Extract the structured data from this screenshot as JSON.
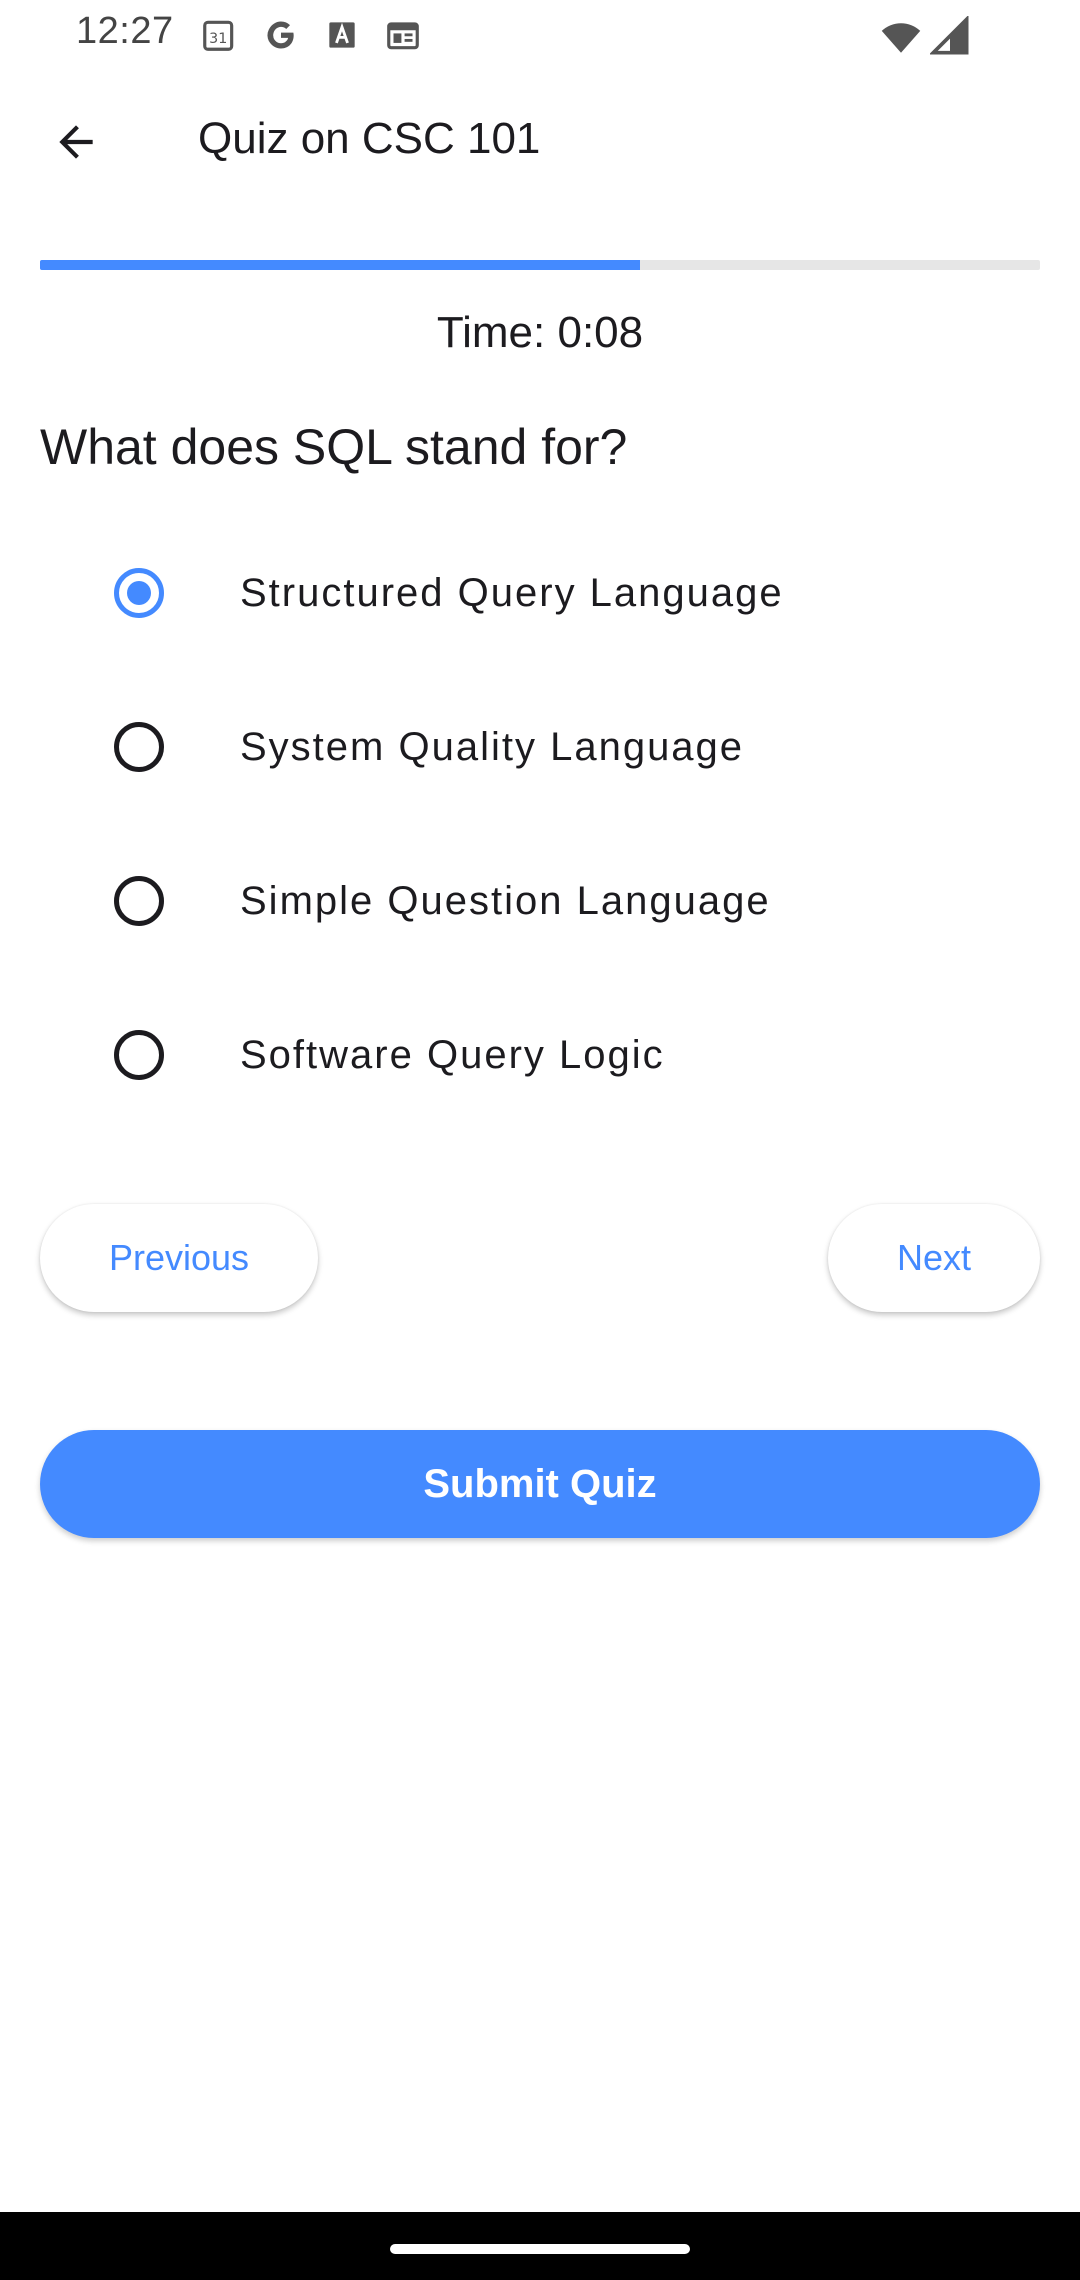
{
  "status_bar": {
    "time": "12:27",
    "calendar_icon_text": "31",
    "icons": [
      "calendar-icon",
      "google-icon",
      "font-icon",
      "news-icon",
      "wifi-icon",
      "signal-icon"
    ]
  },
  "app_bar": {
    "title": "Quiz on CSC 101",
    "back_icon": "arrow-back-icon"
  },
  "progress": {
    "fraction": 0.6
  },
  "timer": {
    "text": "Time: 0:08"
  },
  "question": {
    "text": "What does SQL stand for?",
    "options": [
      {
        "label": "Structured Query Language",
        "selected": true
      },
      {
        "label": "System Quality Language",
        "selected": false
      },
      {
        "label": "Simple Question Language",
        "selected": false
      },
      {
        "label": "Software Query Logic",
        "selected": false
      }
    ]
  },
  "navigation": {
    "previous_label": "Previous",
    "next_label": "Next",
    "submit_label": "Submit Quiz"
  },
  "colors": {
    "accent": "#448aff",
    "track": "#e6e6e6",
    "text": "#1c1b1f"
  }
}
